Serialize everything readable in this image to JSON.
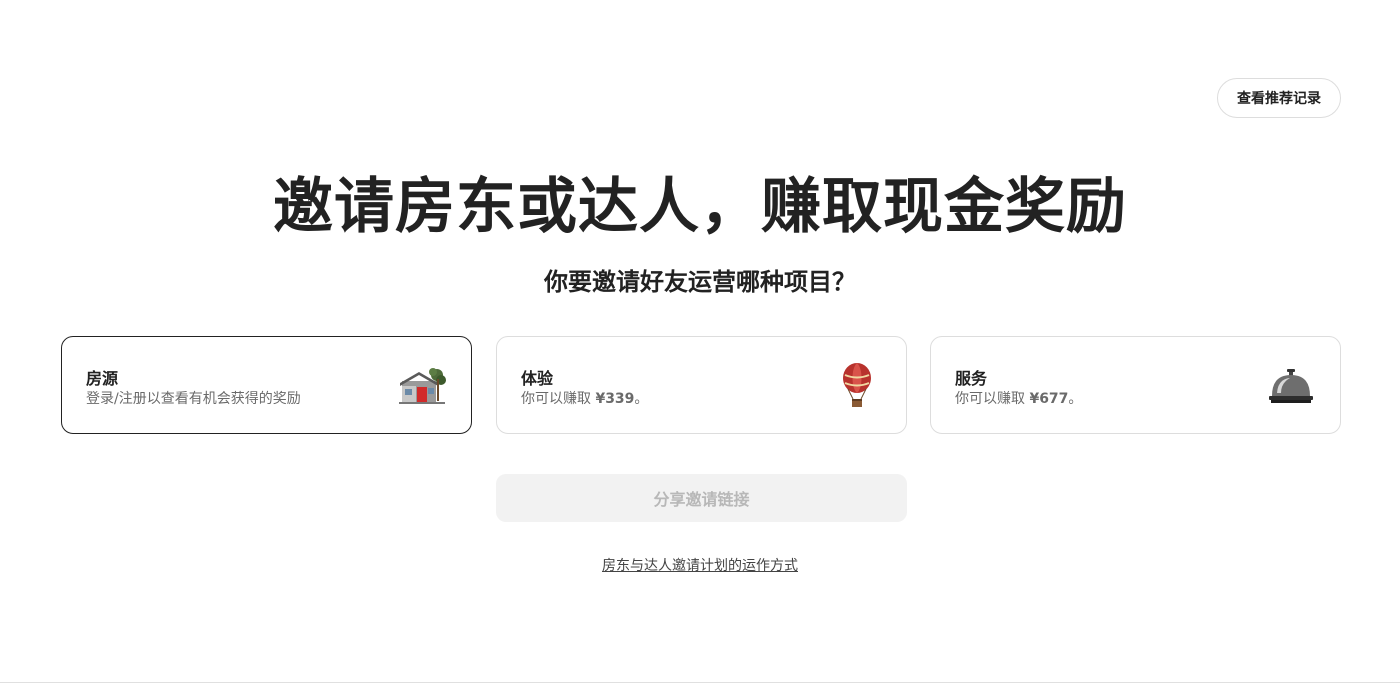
{
  "header": {
    "history_button_label": "查看推荐记录"
  },
  "hero": {
    "title": "邀请房东或达人，赚取现金奖励",
    "subtitle": "你要邀请好友运营哪种项目？"
  },
  "options": [
    {
      "title": "房源",
      "description": "登录/注册以查看有机会获得的奖励",
      "icon": "house-icon",
      "selected": true
    },
    {
      "title": "体验",
      "description_prefix": "你可以赚取 ",
      "amount": "¥339",
      "description_suffix": "。",
      "icon": "hot-air-balloon-icon",
      "selected": false
    },
    {
      "title": "服务",
      "description_prefix": "你可以赚取 ",
      "amount": "¥677",
      "description_suffix": "。",
      "icon": "service-bell-icon",
      "selected": false
    }
  ],
  "share_button_label": "分享邀请链接",
  "how_it_works_link": "房东与达人邀请计划的运作方式",
  "colors": {
    "text_primary": "#222222",
    "text_secondary": "#6a6a6a",
    "border": "#dddddd",
    "selected_border": "#222222",
    "disabled_bg": "#f2f2f2",
    "disabled_text": "#b8b8b8"
  }
}
